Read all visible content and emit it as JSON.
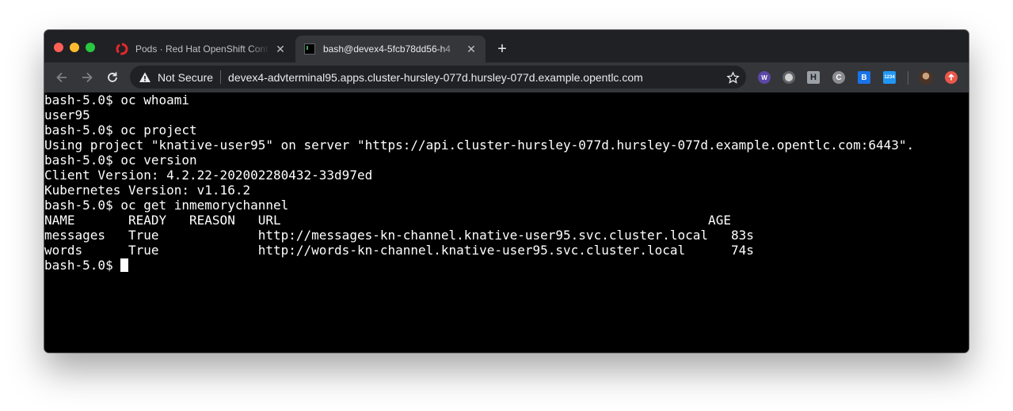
{
  "browser": {
    "tabs": [
      {
        "title": "Pods · Red Hat OpenShift Cont",
        "favicon": "openshift-icon",
        "active": false
      },
      {
        "title": "bash@devex4-5fcb78dd56-h4",
        "favicon": "terminal-icon",
        "active": true
      }
    ],
    "omnibox": {
      "security_label": "Not Secure",
      "url": "devex4-advterminal95.apps.cluster-hursley-077d.hursley-077d.example.opentlc.com"
    },
    "extensions": [
      "wappalyzer-icon",
      "record-icon",
      "extension-h-icon",
      "extension-c-icon",
      "extension-b-icon",
      "extension-blue-icon",
      "profile-avatar",
      "update-icon"
    ],
    "extension_labels": {
      "h": "H",
      "c": "C",
      "b": "B",
      "blue": "1234"
    }
  },
  "terminal": {
    "lines": [
      "bash-5.0$ oc whoami",
      "user95",
      "bash-5.0$ oc project",
      "Using project \"knative-user95\" on server \"https://api.cluster-hursley-077d.hursley-077d.example.opentlc.com:6443\".",
      "bash-5.0$ oc version",
      "Client Version: 4.2.22-202002280432-33d97ed",
      "Kubernetes Version: v1.16.2",
      "bash-5.0$ oc get inmemorychannel",
      "NAME       READY   REASON   URL                                                        AGE",
      "messages   True             http://messages-kn-channel.knative-user95.svc.cluster.local   83s",
      "words      True             http://words-kn-channel.knative-user95.svc.cluster.local      74s"
    ],
    "prompt": "bash-5.0$ "
  },
  "colors": {
    "terminal_bg": "#000000",
    "terminal_fg": "#ffffff",
    "tabstrip_bg": "#202124",
    "toolbar_bg": "#35363a"
  }
}
